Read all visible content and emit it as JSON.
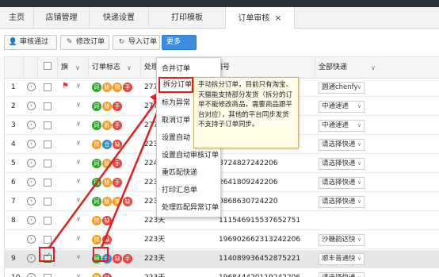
{
  "tabs": [
    {
      "label": "主页"
    },
    {
      "label": "店铺管理"
    },
    {
      "label": "快递设置"
    },
    {
      "label": "打印模板"
    },
    {
      "label": "订单审核",
      "close": "×"
    }
  ],
  "toolbar": {
    "approve": "审核通过",
    "edit": "修改订单",
    "import": "导入订单",
    "more": "更多>>"
  },
  "table": {
    "headers": {
      "flag": "旗",
      "order_flag": "订单标志",
      "process": "处理",
      "number": "编号",
      "express": "全部快递"
    },
    "rows": [
      {
        "index": "1",
        "badges": [
          "同",
          "版",
          "微",
          "手"
        ],
        "process": "277",
        "number": "",
        "express": "圆通chenfy",
        "flag": true,
        "checked": false
      },
      {
        "index": "2",
        "badges": [
          "同",
          "版",
          "手"
        ],
        "process": "277",
        "number": "",
        "express": "中通速递",
        "flag": false,
        "checked": false
      },
      {
        "index": "3",
        "badges": [
          "同",
          "拆",
          "手"
        ],
        "process": "277",
        "number": "",
        "express": "中通速递",
        "flag": false,
        "checked": false
      },
      {
        "index": "4",
        "badges": [
          "微",
          "合",
          "缺"
        ],
        "process": "223",
        "number": "",
        "express": "请选择快递",
        "flag": false,
        "checked": false
      },
      {
        "index": "5",
        "badges": [
          "同",
          "版",
          "手"
        ],
        "process": "224",
        "number": "8724827242206",
        "express": "请选择快递",
        "flag": false,
        "checked": false
      },
      {
        "index": "6",
        "badges": [
          "同",
          "版",
          "手"
        ],
        "process": "223",
        "number": "2641809242206",
        "express": "请选择快递",
        "flag": false,
        "checked": false
      },
      {
        "index": "7",
        "badges": [
          "同",
          "版",
          "微",
          "缺"
        ],
        "process": "223",
        "number": "0868630724220",
        "express": "请选择快递",
        "flag": false,
        "checked": false
      },
      {
        "index": "8",
        "badges": [
          "微",
          "缺"
        ],
        "process": "223天",
        "number": "111546915537652751",
        "express": "",
        "flag": false,
        "checked": false
      },
      {
        "index": "",
        "badges": [
          "微",
          "缺"
        ],
        "process": "223天",
        "number": "196902662313242206",
        "express": "沙糖韵达快",
        "flag": false,
        "checked": false
      },
      {
        "index": "9",
        "badges": [
          "同",
          "合",
          "缺",
          "手"
        ],
        "process": "223天",
        "number": "114089936452875221",
        "express": "顺丰普通快",
        "flag": false,
        "checked": true
      },
      {
        "index": "10",
        "badges": [
          "微",
          "缺"
        ],
        "process": "223天",
        "number": "196844420119242206",
        "express": "请选择快递",
        "flag": false,
        "checked": false
      }
    ]
  },
  "more_menu": {
    "items": [
      "合并订单",
      "拆分订单",
      "标为异常",
      "取消订单",
      "设置自动",
      "设置自动审核订单",
      "重匹配快递",
      "打印汇总单",
      "处理匹配异常订单"
    ]
  },
  "tooltip": {
    "text": "手动拆分订单，目前只有淘宝、天猫能支持部分发货（拆分的订单不能修改商品，需要商品跟平台对应），其他的平台同步发货不支持子订单同步。"
  },
  "colors": {
    "accent": "#3c8dde",
    "highlight": "#e02020",
    "badge_green": "#2aa52a",
    "badge_orange": "#f39a1f",
    "badge_red": "#e8433c"
  }
}
